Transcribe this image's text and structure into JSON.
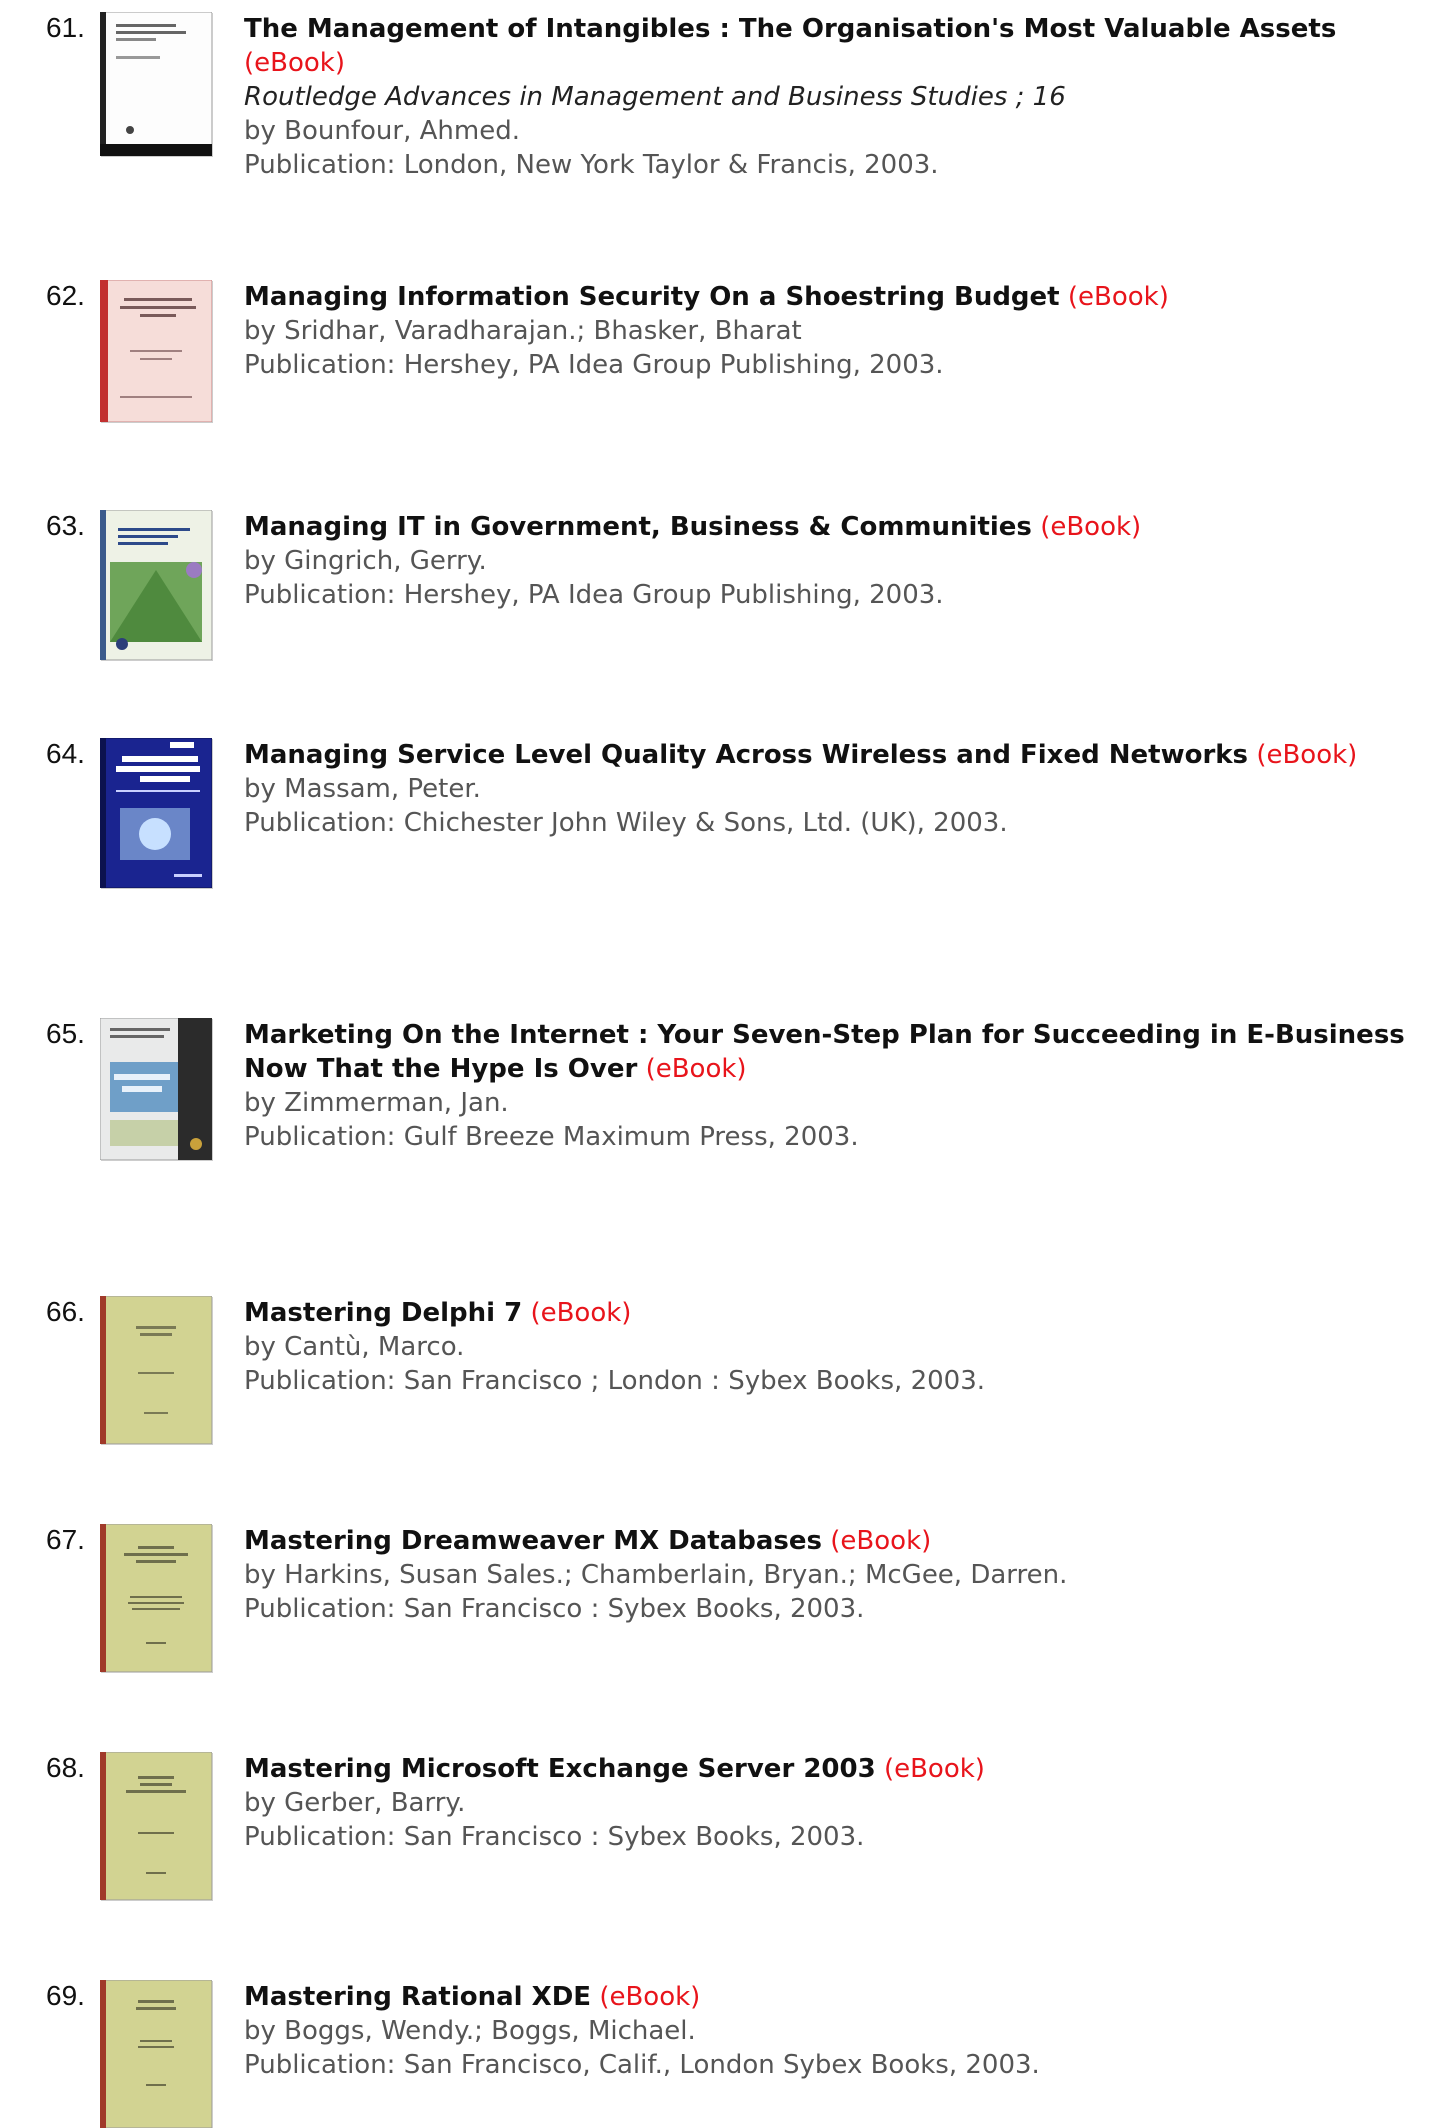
{
  "results": [
    {
      "num": "61.",
      "title": "The Management of Intangibles : The Organisation's Most Valuable Assets",
      "format": "(eBook)",
      "series": "Routledge Advances in Management and Business Studies ; 16",
      "authors": "by Bounfour, Ahmed.",
      "publication": "Publication: London, New York Taylor & Francis, 2003.",
      "cover_color": "#ffffff"
    },
    {
      "num": "62.",
      "title": "Managing Information Security On a Shoestring Budget",
      "format": "(eBook)",
      "series": "",
      "authors": "by Sridhar, Varadharajan.; Bhasker, Bharat",
      "publication": "Publication: Hershey, PA Idea Group Publishing, 2003.",
      "cover_color": "#f3d6d2"
    },
    {
      "num": "63.",
      "title": "Managing IT in Government, Business & Communities",
      "format": "(eBook)",
      "series": "",
      "authors": "by Gingrich, Gerry.",
      "publication": "Publication: Hershey, PA Idea Group Publishing, 2003.",
      "cover_color": "#7fb06a"
    },
    {
      "num": "64.",
      "title": "Managing Service Level Quality Across Wireless and Fixed Networks",
      "format": "(eBook)",
      "series": "",
      "authors": "by Massam, Peter.",
      "publication": "Publication: Chichester John Wiley & Sons, Ltd. (UK), 2003.",
      "cover_color": "#1d2a9a"
    },
    {
      "num": "65.",
      "title": "Marketing On the Internet : Your Seven-Step Plan for Succeeding in E-Business Now That the Hype Is Over",
      "format": "(eBook)",
      "series": "",
      "authors": "by Zimmerman, Jan.",
      "publication": "Publication: Gulf Breeze Maximum Press, 2003.",
      "cover_color": "#6f9fc8"
    },
    {
      "num": "66.",
      "title": "Mastering Delphi 7",
      "format": "(eBook)",
      "series": "",
      "authors": "by Cantù, Marco.",
      "publication": "Publication: San Francisco ; London : Sybex Books, 2003.",
      "cover_color": "#cfd08e"
    },
    {
      "num": "67.",
      "title": "Mastering Dreamweaver MX Databases",
      "format": "(eBook)",
      "series": "",
      "authors": "by Harkins, Susan Sales.; Chamberlain, Bryan.; McGee, Darren.",
      "publication": "Publication: San Francisco : Sybex Books, 2003.",
      "cover_color": "#cfd08e"
    },
    {
      "num": "68.",
      "title": "Mastering Microsoft Exchange Server 2003",
      "format": "(eBook)",
      "series": "",
      "authors": "by Gerber, Barry.",
      "publication": "Publication: San Francisco : Sybex Books, 2003.",
      "cover_color": "#cfd08e"
    },
    {
      "num": "69.",
      "title": "Mastering Rational XDE",
      "format": "(eBook)",
      "series": "",
      "authors": "by Boggs, Wendy.; Boggs, Michael.",
      "publication": "Publication: San Francisco, Calif., London Sybex Books, 2003.",
      "cover_color": "#cfd08e"
    }
  ]
}
